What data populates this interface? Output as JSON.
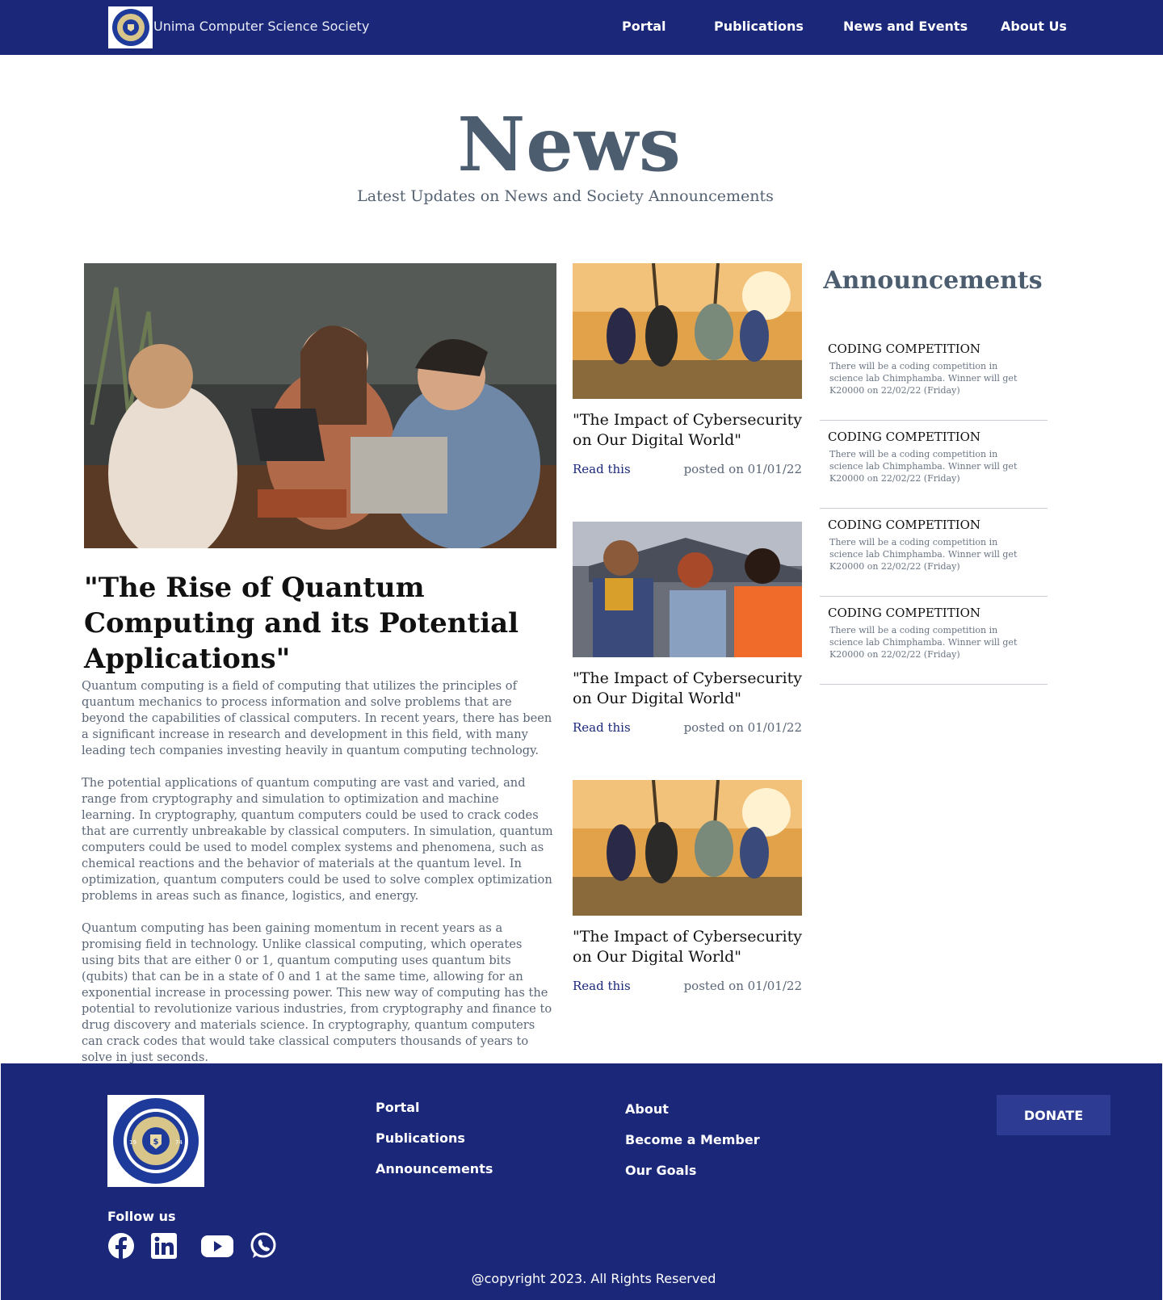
{
  "nav": {
    "brand": "Unima Computer Science Society",
    "links": [
      "Portal",
      "Publications",
      "News and Events",
      "About Us"
    ],
    "logo_seal_text": "UNIVERSITY OF MALAWI COMPUTER SCIENCE SOCIETY 1974"
  },
  "hero": {
    "title": "News",
    "subtitle": "Latest Updates on News and Society Announcements"
  },
  "feature": {
    "title": "\"The Rise of Quantum Computing and its Potential Applications\"",
    "paragraphs": [
      "Quantum computing is a field of computing that utilizes the principles of quantum mechanics to process information and solve problems that are beyond the capabilities of classical computers. In recent years, there has been a significant increase in research and development in this field, with many leading tech companies investing heavily in quantum computing technology.",
      "The potential applications of quantum computing are vast and varied, and range from cryptography and simulation to optimization and machine learning. In cryptography, quantum computers could be used to crack codes that are currently unbreakable by classical computers. In simulation, quantum computers could be used to model complex systems and phenomena, such as chemical reactions and the behavior of materials at the quantum level. In optimization, quantum computers could be used to solve complex optimization problems in areas such as finance, logistics, and energy.",
      "Quantum computing has been gaining momentum in recent years as a promising field in technology. Unlike classical computing, which operates using bits that are either 0 or 1, quantum computing uses quantum bits (qubits) that can be in a state of 0 and 1 at the same time, allowing for an exponential increase in processing power. This new way of computing has the potential to revolutionize various industries, from cryptography and finance to drug discovery and materials science. In cryptography, quantum computers can crack codes that would take classical computers thousands of years to solve in just seconds."
    ]
  },
  "cards": [
    {
      "title": "\"The Impact of Cybersecurity on Our Digital World\"",
      "link": "Read this",
      "posted": "posted on 01/01/22"
    },
    {
      "title": "\"The Impact of Cybersecurity on Our Digital World\"",
      "link": "Read this",
      "posted": "posted on 01/01/22"
    },
    {
      "title": "\"The Impact of Cybersecurity on Our Digital World\"",
      "link": "Read this",
      "posted": "posted on 01/01/22"
    }
  ],
  "announcements": {
    "heading": "Announcements",
    "items": [
      {
        "title": "CODING COMPETITION",
        "text": "There will be a coding competition in science lab Chimphamba. Winner will get K20000 on 22/02/22 (Friday)"
      },
      {
        "title": "CODING COMPETITION",
        "text": "There will be a coding competition in science lab Chimphamba. Winner will get K20000 on 22/02/22 (Friday)"
      },
      {
        "title": "CODING COMPETITION",
        "text": "There will be a coding competition in science lab Chimphamba. Winner will get K20000 on 22/02/22 (Friday)"
      },
      {
        "title": "CODING COMPETITION",
        "text": "There will be a coding competition in science lab Chimphamba. Winner will get K20000 on 22/02/22 (Friday)"
      }
    ]
  },
  "footer": {
    "col1": [
      "Portal",
      "Publications",
      "Announcements"
    ],
    "col2": [
      "About",
      "Become a Member",
      "Our Goals"
    ],
    "donate": "DONATE",
    "follow": "Follow us",
    "social_icons": [
      "facebook-icon",
      "linkedin-icon",
      "youtube-icon",
      "whatsapp-icon"
    ],
    "copyright": "@copyright 2023. All Rights Reserved"
  },
  "colors": {
    "brand_navy": "#1b287a",
    "heading_slate": "#4d5d70",
    "donate_bg": "#2d3b92"
  }
}
